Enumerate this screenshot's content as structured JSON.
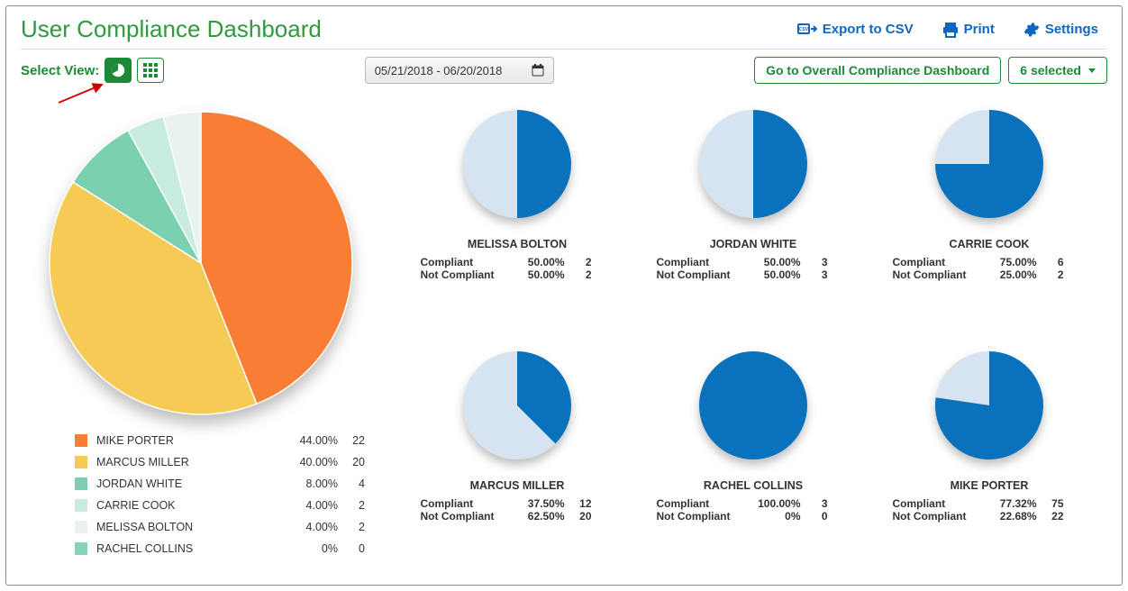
{
  "header": {
    "title": "User Compliance Dashboard",
    "export_label": "Export to CSV",
    "print_label": "Print",
    "settings_label": "Settings"
  },
  "controls": {
    "select_view_label": "Select View:",
    "date_range": "05/21/2018 - 06/20/2018",
    "overall_btn": "Go to Overall Compliance Dashboard",
    "selected_label": "6 selected"
  },
  "overview_legend": [
    {
      "name": "MIKE PORTER",
      "pct": "44.00%",
      "count": "22",
      "color": "#f77e34"
    },
    {
      "name": "MARCUS MILLER",
      "pct": "40.00%",
      "count": "20",
      "color": "#f6cb55"
    },
    {
      "name": "JORDAN WHITE",
      "pct": "8.00%",
      "count": "4",
      "color": "#7bd0b0"
    },
    {
      "name": "CARRIE COOK",
      "pct": "4.00%",
      "count": "2",
      "color": "#c8ebe0"
    },
    {
      "name": "MELISSA BOLTON",
      "pct": "4.00%",
      "count": "2",
      "color": "#e8f3ef"
    },
    {
      "name": "RACHEL COLLINS",
      "pct": "0%",
      "count": "0",
      "color": "#85d4b7"
    }
  ],
  "labels": {
    "compliant": "Compliant",
    "not_compliant": "Not Compliant"
  },
  "users": [
    {
      "name": "MELISSA BOLTON",
      "compliant_pct": "50.00%",
      "compliant_cnt": "2",
      "noncompliant_pct": "50.00%",
      "noncompliant_cnt": "2",
      "compliant_frac": 0.5
    },
    {
      "name": "JORDAN WHITE",
      "compliant_pct": "50.00%",
      "compliant_cnt": "3",
      "noncompliant_pct": "50.00%",
      "noncompliant_cnt": "3",
      "compliant_frac": 0.5
    },
    {
      "name": "CARRIE COOK",
      "compliant_pct": "75.00%",
      "compliant_cnt": "6",
      "noncompliant_pct": "25.00%",
      "noncompliant_cnt": "2",
      "compliant_frac": 0.75
    },
    {
      "name": "MARCUS MILLER",
      "compliant_pct": "37.50%",
      "compliant_cnt": "12",
      "noncompliant_pct": "62.50%",
      "noncompliant_cnt": "20",
      "compliant_frac": 0.375
    },
    {
      "name": "RACHEL COLLINS",
      "compliant_pct": "100.00%",
      "compliant_cnt": "3",
      "noncompliant_pct": "0%",
      "noncompliant_cnt": "0",
      "compliant_frac": 1.0
    },
    {
      "name": "MIKE PORTER",
      "compliant_pct": "77.32%",
      "compliant_cnt": "75",
      "noncompliant_pct": "22.68%",
      "noncompliant_cnt": "22",
      "compliant_frac": 0.7732
    }
  ],
  "chart_data": [
    {
      "type": "pie",
      "title": "Overview by user (share of total)",
      "categories": [
        "MIKE PORTER",
        "MARCUS MILLER",
        "JORDAN WHITE",
        "CARRIE COOK",
        "MELISSA BOLTON",
        "RACHEL COLLINS"
      ],
      "values": [
        44.0,
        40.0,
        8.0,
        4.0,
        4.0,
        0.0
      ],
      "counts": [
        22,
        20,
        4,
        2,
        2,
        0
      ],
      "colors": [
        "#f77e34",
        "#f6cb55",
        "#7bd0b0",
        "#c8ebe0",
        "#e8f3ef",
        "#85d4b7"
      ]
    },
    {
      "type": "pie",
      "title": "MELISSA BOLTON compliance",
      "categories": [
        "Compliant",
        "Not Compliant"
      ],
      "values": [
        50.0,
        50.0
      ],
      "counts": [
        2,
        2
      ]
    },
    {
      "type": "pie",
      "title": "JORDAN WHITE compliance",
      "categories": [
        "Compliant",
        "Not Compliant"
      ],
      "values": [
        50.0,
        50.0
      ],
      "counts": [
        3,
        3
      ]
    },
    {
      "type": "pie",
      "title": "CARRIE COOK compliance",
      "categories": [
        "Compliant",
        "Not Compliant"
      ],
      "values": [
        75.0,
        25.0
      ],
      "counts": [
        6,
        2
      ]
    },
    {
      "type": "pie",
      "title": "MARCUS MILLER compliance",
      "categories": [
        "Compliant",
        "Not Compliant"
      ],
      "values": [
        37.5,
        62.5
      ],
      "counts": [
        12,
        20
      ]
    },
    {
      "type": "pie",
      "title": "RACHEL COLLINS compliance",
      "categories": [
        "Compliant",
        "Not Compliant"
      ],
      "values": [
        100.0,
        0.0
      ],
      "counts": [
        3,
        0
      ]
    },
    {
      "type": "pie",
      "title": "MIKE PORTER compliance",
      "categories": [
        "Compliant",
        "Not Compliant"
      ],
      "values": [
        77.32,
        22.68
      ],
      "counts": [
        75,
        22
      ]
    }
  ]
}
